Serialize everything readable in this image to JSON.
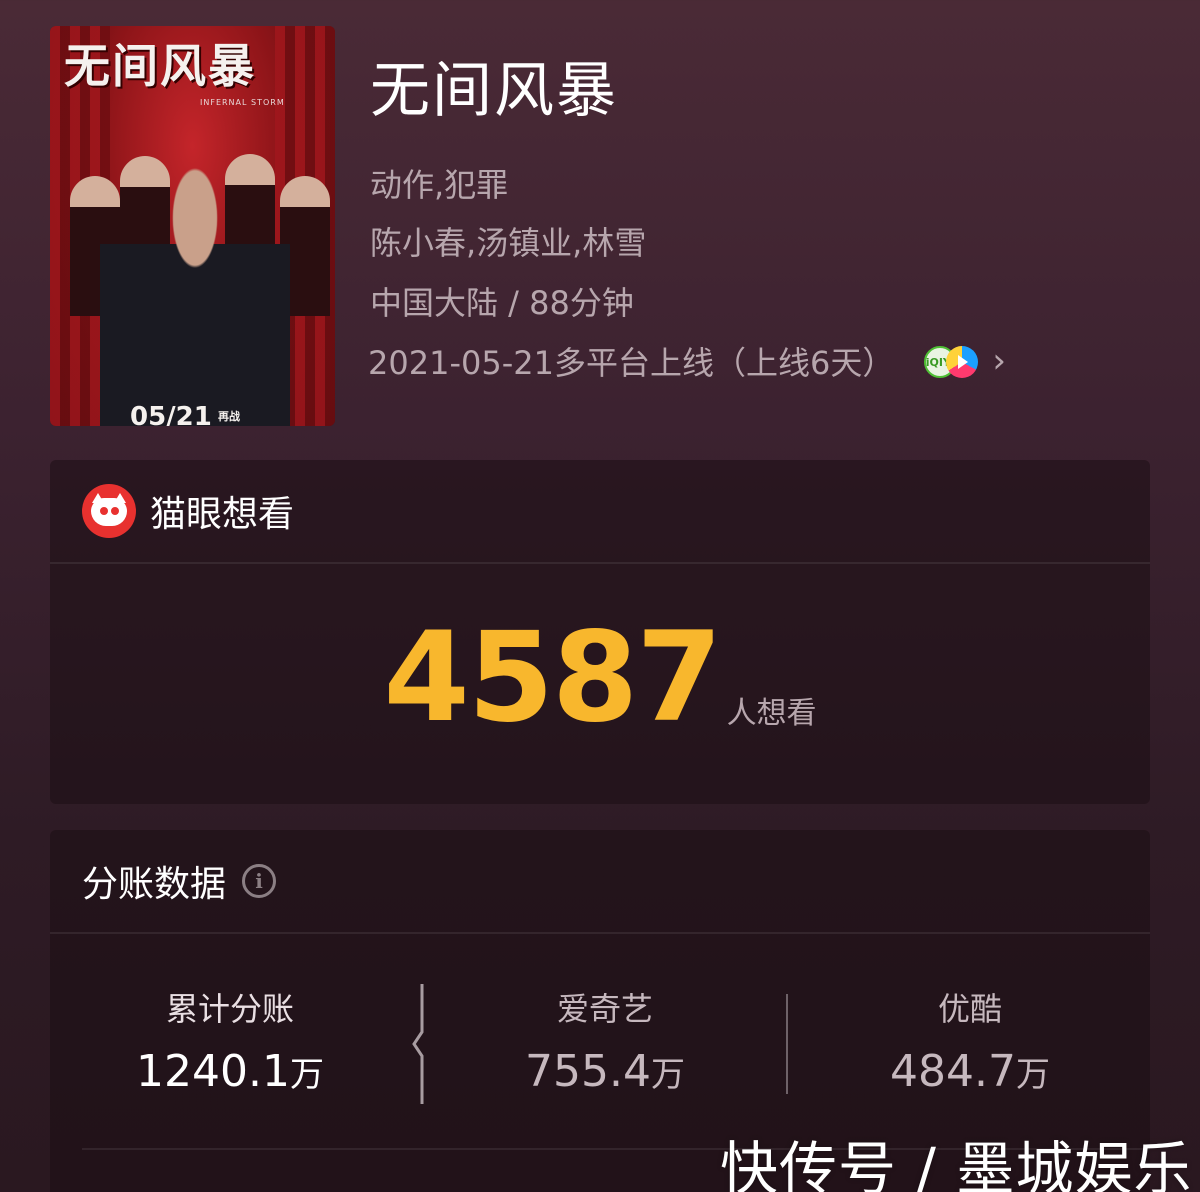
{
  "poster": {
    "title_text": "无间风暴",
    "subtitle_text": "INFERNAL STORM",
    "date_text": "05/21",
    "date_tag": "再战"
  },
  "movie": {
    "title": "无间风暴",
    "genres": "动作,犯罪",
    "cast": "陈小春,汤镇业,林雪",
    "region_duration": "中国大陆 / 88分钟",
    "release": "2021-05-21多平台上线（上线6天）",
    "platform_icons": [
      "iqiyi-icon",
      "youku-icon"
    ],
    "iqiyi_icon_text": "iQIYI"
  },
  "want_card": {
    "title": "猫眼想看",
    "count": "4587",
    "unit": "人想看",
    "accent_color": "#f8b72d"
  },
  "box_card": {
    "title": "分账数据",
    "stats": [
      {
        "label": "累计分账",
        "value": "1240.1",
        "unit": "万"
      },
      {
        "label": "爱奇艺",
        "value": "755.4",
        "unit": "万"
      },
      {
        "label": "优酷",
        "value": "484.7",
        "unit": "万"
      }
    ]
  },
  "watermark": "快传号 / 墨城娱乐"
}
